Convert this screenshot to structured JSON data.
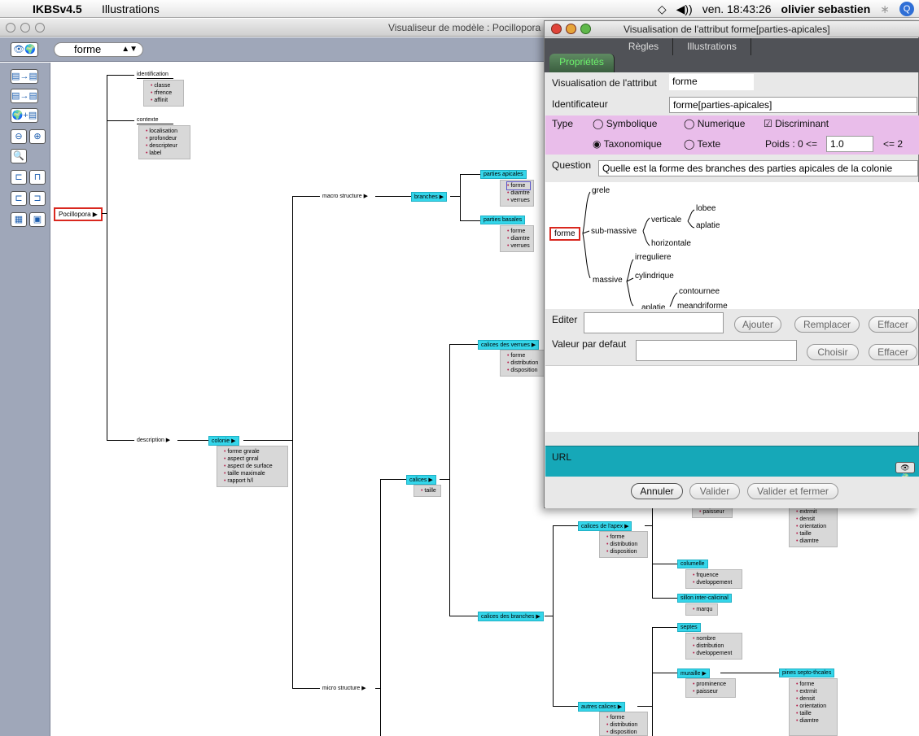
{
  "menubar": {
    "app_name": "IKBSv4.5",
    "menu": "Illustrations",
    "clock": "ven. 18:43:26",
    "user": "olivier sebastien"
  },
  "main_window": {
    "title": "Visualiseur de modèle : Pocillopora",
    "selector_value": "forme"
  },
  "tree": {
    "root": "Pocillopora",
    "identification": {
      "label": "identification",
      "items": [
        "classe",
        "rfrence",
        "affinit"
      ]
    },
    "contexte": {
      "label": "contexte",
      "items": [
        "localisation",
        "profondeur",
        "descripteur",
        "label"
      ]
    },
    "description": "description",
    "colonie": {
      "label": "colonie",
      "items": [
        "forme gnrale",
        "aspect gnral",
        "aspect de surface",
        "taille maximale",
        "rapport h/l"
      ]
    },
    "macro_structure": "macro structure",
    "branches": "branches",
    "parties_apicales": {
      "label": "parties apicales",
      "items": [
        "forme",
        "diamtre",
        "verrues"
      ]
    },
    "parties_basales": {
      "label": "parties basales",
      "items": [
        "forme",
        "diamtre",
        "verrues"
      ]
    },
    "calices_verrues": {
      "label": "calices des verrues",
      "items": [
        "forme",
        "distribution",
        "disposition"
      ]
    },
    "calices": {
      "label": "calices",
      "items": [
        "taille"
      ]
    },
    "paisseur_box": [
      "paisseur"
    ],
    "extrmit_box": [
      "extrmit",
      "densit",
      "orientation",
      "taille",
      "diamtre"
    ],
    "calices_apex": {
      "label": "calices de l'apex",
      "items": [
        "forme",
        "distribution",
        "disposition"
      ]
    },
    "columelle": {
      "label": "columelle",
      "items": [
        "frquence",
        "dveloppement"
      ]
    },
    "sillon": {
      "label": "sillon inter-calicinal",
      "items": [
        "marqu"
      ]
    },
    "calices_branches": "calices des branches",
    "septes": {
      "label": "septes",
      "items": [
        "nombre",
        "distribution",
        "dveloppement"
      ]
    },
    "muraille": {
      "label": "muraille",
      "items": [
        "prominence",
        "paisseur"
      ]
    },
    "epines": {
      "label": "pines septo-thcales",
      "items": [
        "forme",
        "extrmit",
        "densit",
        "orientation",
        "taille",
        "diamtre"
      ]
    },
    "micro_structure": "micro structure",
    "autres_calices": {
      "label": "autres calices",
      "items": [
        "forme",
        "distribution",
        "disposition"
      ]
    }
  },
  "dialog": {
    "title": "Visualisation de l'attribut forme[parties-apicales]",
    "tabs": [
      "Propriétés",
      "Règles",
      "Illustrations"
    ],
    "attr_label": "Visualisation de l'attribut",
    "attr_value": "forme",
    "ident_label": "Identificateur",
    "ident_value": "forme[parties-apicales]",
    "type_label": "Type",
    "type_options": [
      "Symbolique",
      "Numerique",
      "Discriminant",
      "Taxonomique",
      "Texte"
    ],
    "poids_label": "Poids : 0 <=",
    "poids_value": "1.0",
    "poids_max": "<= 2",
    "question_label": "Question",
    "question_value": "Quelle est la forme des branches des parties apicales de la colonie",
    "value_tree": {
      "root": "forme",
      "grele": "grele",
      "sub_massive": "sub-massive",
      "verticale": "verticale",
      "lobee": "lobee",
      "aplatie": "aplatie",
      "horizontale": "horizontale",
      "massive": "massive",
      "irreguliere": "irreguliere",
      "cylindrique": "cylindrique",
      "contournee": "contournee",
      "aplatie2": "aplatie",
      "meandriforme": "meandriforme"
    },
    "editer_label": "Editer",
    "btn_ajouter": "Ajouter",
    "btn_remplacer": "Remplacer",
    "btn_effacer": "Effacer",
    "defaut_label": "Valeur par defaut",
    "btn_choisir": "Choisir",
    "url_label": "URL",
    "btn_annuler": "Annuler",
    "btn_valider": "Valider",
    "btn_valider_fermer": "Valider et fermer"
  }
}
